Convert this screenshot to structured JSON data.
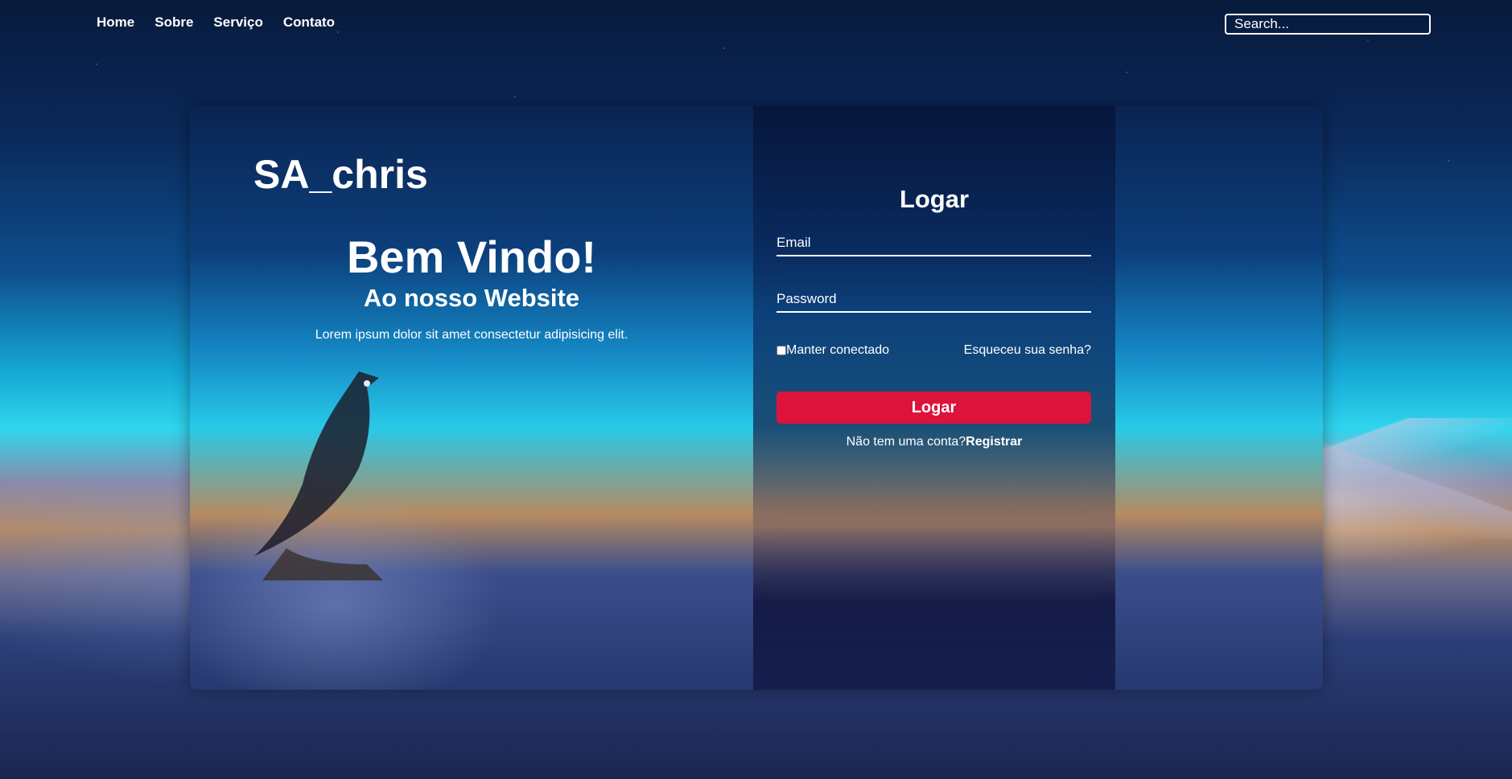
{
  "nav": {
    "links": [
      "Home",
      "Sobre",
      "Serviço",
      "Contato"
    ],
    "search_placeholder": "Search..."
  },
  "brand": "SA_chris",
  "welcome": {
    "title": "Bem Vindo!",
    "subtitle": "Ao nosso Website",
    "text": "Lorem ipsum dolor sit amet consectetur adipisicing elit."
  },
  "login": {
    "title": "Logar",
    "email_placeholder": "Email",
    "password_placeholder": "Password",
    "remember_label": "Manter conectado",
    "forgot_label": "Esqueceu sua senha?",
    "button_label": "Logar",
    "register_prompt": "Não tem uma conta?",
    "register_link": "Registrar"
  },
  "colors": {
    "accent": "#dc143c",
    "text": "#ffffff"
  }
}
